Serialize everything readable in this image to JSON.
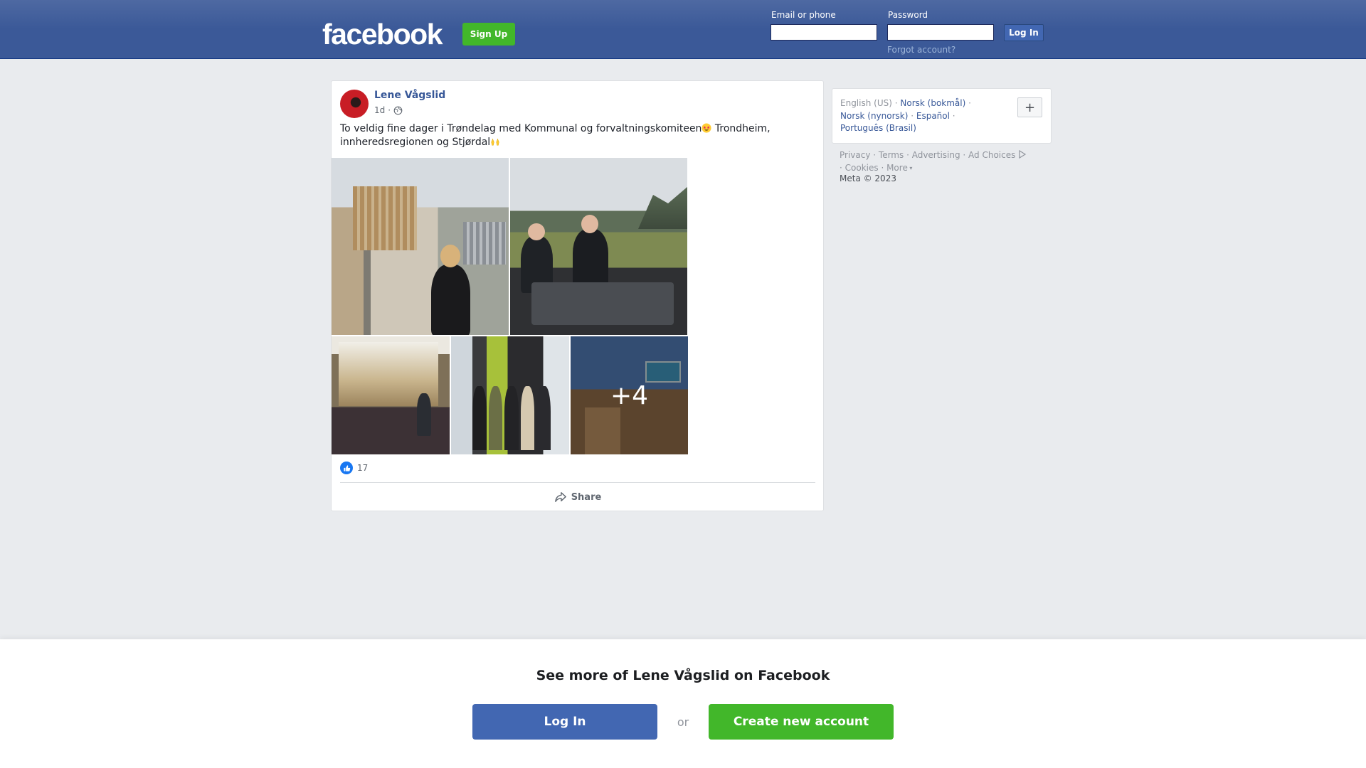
{
  "header": {
    "logo_text": "facebook",
    "signup_label": "Sign Up",
    "email_label": "Email or phone",
    "email_value": "",
    "password_label": "Password",
    "password_value": "",
    "login_label": "Log In",
    "forgot_label": "Forgot account?"
  },
  "post": {
    "author": "Lene Vågslid",
    "time": "1d",
    "privacy_icon": "globe-icon",
    "text": "To veldig fine dager i Trøndelag med Kommunal og forvaltningskomiteen",
    "text_emoji_1": "star-struck-emoji",
    "text_cont": " Trondheim, innheredsregionen og Stjørdal",
    "text_emoji_2": "raising-hands-emoji",
    "more_photos_count": "+4",
    "reaction_icon": "like-icon",
    "reaction_count": "17",
    "share_label": "Share"
  },
  "sidebar": {
    "languages": [
      {
        "label": "English (US)",
        "current": true
      },
      {
        "label": "Norsk (bokmål)",
        "current": false
      },
      {
        "label": "Norsk (nynorsk)",
        "current": false
      },
      {
        "label": "Español",
        "current": false
      },
      {
        "label": "Português (Brasil)",
        "current": false
      }
    ],
    "add_language_label": "+",
    "footer_links": [
      "Privacy",
      "Terms",
      "Advertising",
      "Ad Choices",
      "Cookies",
      "More"
    ],
    "copyright": "Meta © 2023"
  },
  "banner": {
    "title": "See more of Lene Vågslid on Facebook",
    "login_label": "Log In",
    "or_label": "or",
    "create_label": "Create new account"
  },
  "colors": {
    "brand_blue": "#3b5998",
    "green": "#42b72a",
    "link": "#385898",
    "page_bg": "#e9ebee"
  }
}
